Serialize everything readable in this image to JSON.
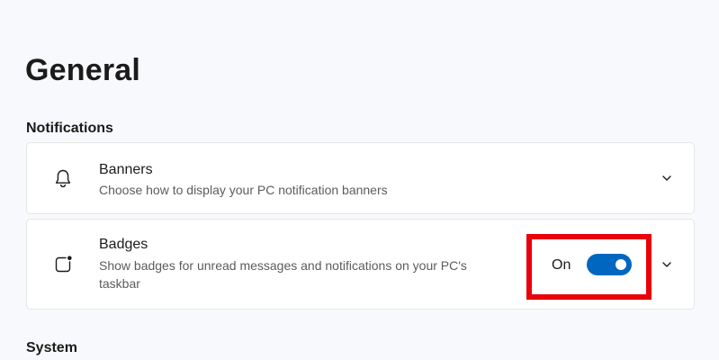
{
  "page": {
    "title": "General"
  },
  "sections": {
    "notifications": "Notifications",
    "system": "System"
  },
  "banners": {
    "title": "Banners",
    "description": "Choose how to display your PC notification banners",
    "icon": "bell-icon"
  },
  "badges": {
    "title": "Badges",
    "description": "Show badges for unread messages and notifications on your PC's taskbar",
    "icon": "badge-icon",
    "toggle_label": "On",
    "toggle_state": true
  },
  "colors": {
    "accent": "#0067c0",
    "highlight": "#e8000b",
    "background": "#f8f9fc"
  }
}
